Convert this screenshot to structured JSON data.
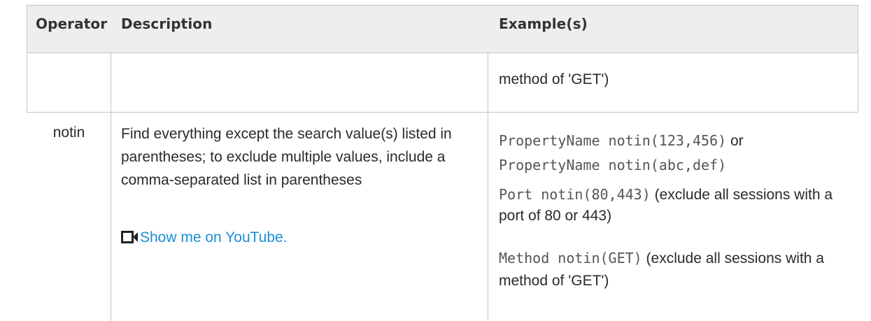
{
  "table": {
    "headers": {
      "operator": "Operator",
      "description": "Description",
      "examples": "Example(s)"
    },
    "continued_row": {
      "example_tail": "method of 'GET')"
    },
    "row_notin": {
      "operator": "notin",
      "description": "Find everything except the search value(s) listed in parentheses; to exclude multiple values, include a comma-separated list in parentheses",
      "video_icon": "video-camera-icon",
      "video_link": "Show me on YouTube.",
      "example1_code_a": "PropertyName notin(123,456)",
      "example1_or": " or",
      "example1_code_b": "PropertyName notin(abc,def)",
      "example2_code": "Port notin(80,443)",
      "example2_text": " (exclude all sessions with a port of 80 or 443)",
      "example3_code": "Method notin(GET)",
      "example3_text": " (exclude all sessions with a method of 'GET')"
    }
  },
  "colors": {
    "header_bg": "#eeeeee",
    "border": "#c4c4c4",
    "link": "#1a8dd6",
    "code": "#555555"
  }
}
